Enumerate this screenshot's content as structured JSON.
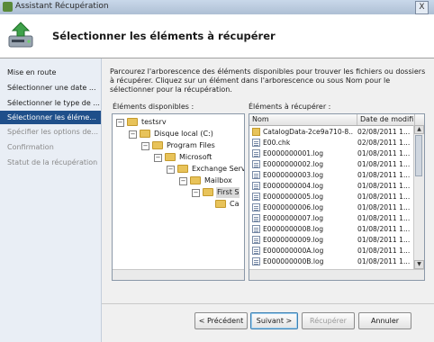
{
  "window": {
    "title": "Assistant Récupération",
    "close_glyph": "X"
  },
  "header": {
    "title": "Sélectionner les éléments à récupérer",
    "icon": "recovery-wizard-icon"
  },
  "nav": {
    "items": [
      {
        "label": "Mise en route",
        "state": "normal"
      },
      {
        "label": "Sélectionner une date ...",
        "state": "normal"
      },
      {
        "label": "Sélectionner le type de ...",
        "state": "normal"
      },
      {
        "label": "Sélectionner les éléme...",
        "state": "active"
      },
      {
        "label": "Spécifier les options de...",
        "state": "disabled"
      },
      {
        "label": "Confirmation",
        "state": "disabled"
      },
      {
        "label": "Statut de la récupération",
        "state": "disabled"
      }
    ]
  },
  "content": {
    "intro": "Parcourez l'arborescence des éléments disponibles pour trouver les fichiers ou dossiers à récupérer. Cliquez sur un élément dans l'arborescence ou sous Nom pour le sélectionner pour la récupération.",
    "available_label": "Éléments disponibles :",
    "recover_label": "Éléments à récupérer :",
    "tree": [
      {
        "label": "testsrv",
        "expander": "−"
      },
      {
        "label": "Disque local (C:)",
        "expander": "−"
      },
      {
        "label": "Program Files",
        "expander": "−"
      },
      {
        "label": "Microsoft",
        "expander": "−"
      },
      {
        "label": "Exchange Serv",
        "expander": "−"
      },
      {
        "label": "Mailbox",
        "expander": "−"
      },
      {
        "label": "First S",
        "expander": "−"
      },
      {
        "label": "Ca",
        "expander": ""
      }
    ],
    "table": {
      "columns": [
        "Nom",
        "Date de modifi..."
      ],
      "rows": [
        {
          "name": "CatalogData-2ce9a710-8...",
          "date": "02/08/2011 1...",
          "icon": "folder"
        },
        {
          "name": "E00.chk",
          "date": "02/08/2011 1...",
          "icon": "file"
        },
        {
          "name": "E0000000001.log",
          "date": "01/08/2011 1...",
          "icon": "file"
        },
        {
          "name": "E0000000002.log",
          "date": "01/08/2011 1...",
          "icon": "file"
        },
        {
          "name": "E0000000003.log",
          "date": "01/08/2011 1...",
          "icon": "file"
        },
        {
          "name": "E0000000004.log",
          "date": "01/08/2011 1...",
          "icon": "file"
        },
        {
          "name": "E0000000005.log",
          "date": "01/08/2011 1...",
          "icon": "file"
        },
        {
          "name": "E0000000006.log",
          "date": "01/08/2011 1...",
          "icon": "file"
        },
        {
          "name": "E0000000007.log",
          "date": "01/08/2011 1...",
          "icon": "file"
        },
        {
          "name": "E0000000008.log",
          "date": "01/08/2011 1...",
          "icon": "file"
        },
        {
          "name": "E0000000009.log",
          "date": "01/08/2011 1...",
          "icon": "file"
        },
        {
          "name": "E000000000A.log",
          "date": "01/08/2011 1...",
          "icon": "file"
        },
        {
          "name": "E000000000B.log",
          "date": "01/08/2011 1...",
          "icon": "file"
        }
      ]
    }
  },
  "buttons": {
    "previous": "< Précédent",
    "next": "Suivant >",
    "recover": "Récupérer",
    "cancel": "Annuler"
  }
}
